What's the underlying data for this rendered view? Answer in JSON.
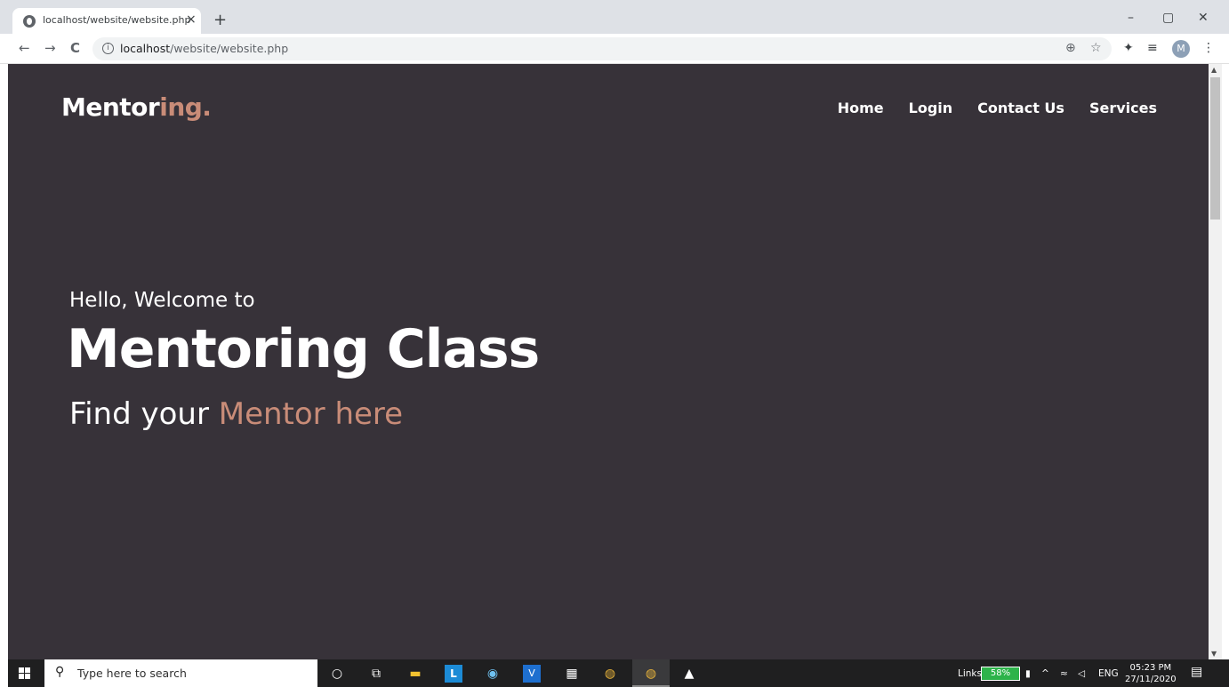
{
  "browser": {
    "tab_title": "localhost/website/website.php",
    "tab_close": "×",
    "new_tab": "+",
    "window_controls": {
      "minimize": "–",
      "maximize": "▢",
      "close": "✕"
    },
    "nav": {
      "back": "←",
      "forward": "→",
      "reload": "C"
    },
    "url_host": "localhost",
    "url_path": "/website/website.php",
    "avatar_initial": "M"
  },
  "site": {
    "logo_main": "Mentor",
    "logo_accent": "ing.",
    "nav": [
      "Home",
      "Login",
      "Contact Us",
      "Services"
    ],
    "hero_sub": "Hello, Welcome to",
    "hero_title": "Mentoring Class",
    "hero_tag_plain": "Find your ",
    "hero_tag_accent": "Mentor here",
    "accent_color": "#c98c78",
    "background_color": "#373239"
  },
  "taskbar": {
    "search_placeholder": "Type here to search",
    "links_label": "Links",
    "battery": "58%",
    "language": "ENG",
    "time": "05:23 PM",
    "date": "27/11/2020"
  }
}
